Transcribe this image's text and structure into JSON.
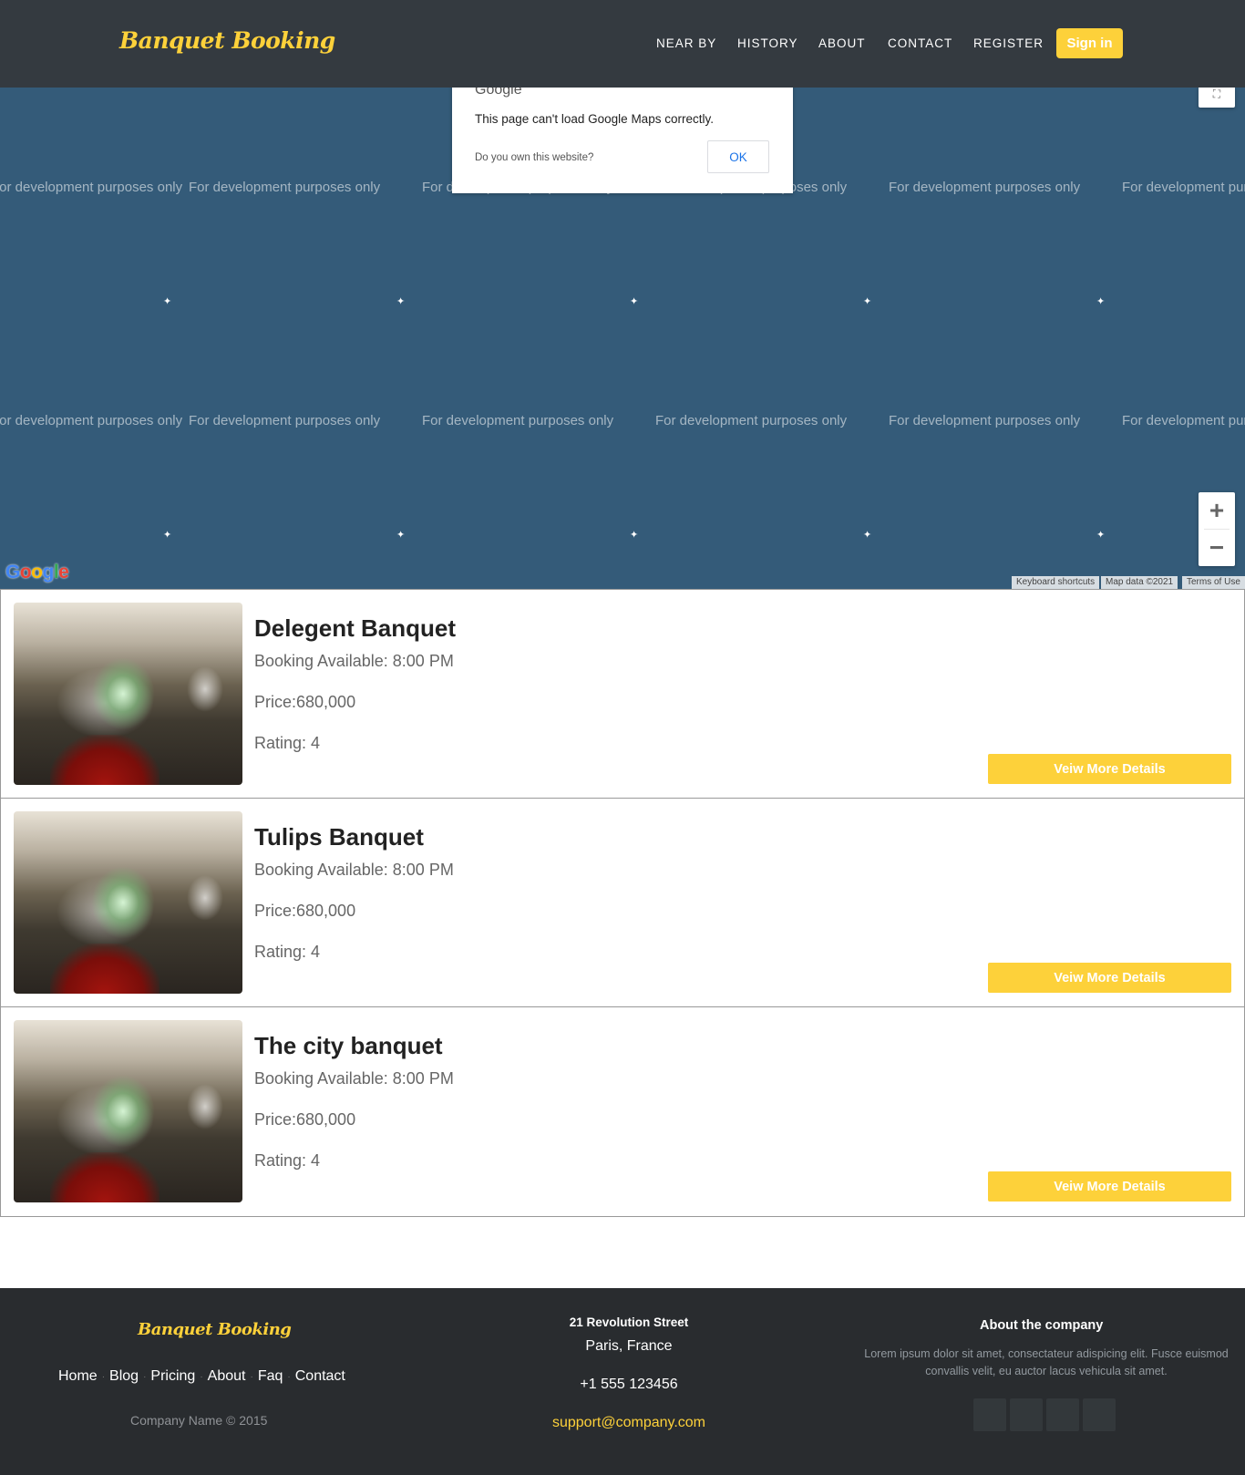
{
  "header": {
    "brand": "Banquet Booking",
    "nav": [
      "NEAR BY",
      "HISTORY",
      "ABOUT",
      "CONTACT",
      "REGISTER"
    ],
    "signin": "Sign in"
  },
  "map": {
    "dialog": {
      "logo": "Google",
      "message": "This page can't load Google Maps correctly.",
      "question": "Do you own this website?",
      "ok": "OK"
    },
    "watermark": "For development purposes only",
    "google_logo": "Google",
    "attribution": [
      "Keyboard shortcuts",
      "Map data ©2021",
      "Terms of Use"
    ],
    "zoom_in": "+",
    "zoom_out": "−"
  },
  "listings": [
    {
      "name": "Delegent Banquet",
      "booking": "Booking Available: 8:00 PM",
      "price": "Price:680,000",
      "rating": "Rating: 4",
      "button": "Veiw More Details"
    },
    {
      "name": "Tulips Banquet",
      "booking": "Booking Available: 8:00 PM",
      "price": "Price:680,000",
      "rating": "Rating: 4",
      "button": "Veiw More Details"
    },
    {
      "name": "The city banquet",
      "booking": "Booking Available: 8:00 PM",
      "price": "Price:680,000",
      "rating": "Rating: 4",
      "button": "Veiw More Details"
    }
  ],
  "footer": {
    "brand": "Banquet Booking",
    "links": [
      "Home",
      "Blog",
      "Pricing",
      "About",
      "Faq",
      "Contact"
    ],
    "copyright": "Company Name © 2015",
    "street": "21 Revolution Street",
    "city": "Paris, France",
    "phone": "+1 555 123456",
    "email": "support@company.com",
    "about_heading": "About the company",
    "about_text": "Lorem ipsum dolor sit amet, consectateur adispicing elit. Fusce euismod convallis velit, eu auctor lacus vehicula sit amet."
  },
  "colors": {
    "accent": "#fdd13a",
    "header_bg": "#343a40",
    "map_bg": "#345b79",
    "footer_bg": "#292c2f"
  }
}
